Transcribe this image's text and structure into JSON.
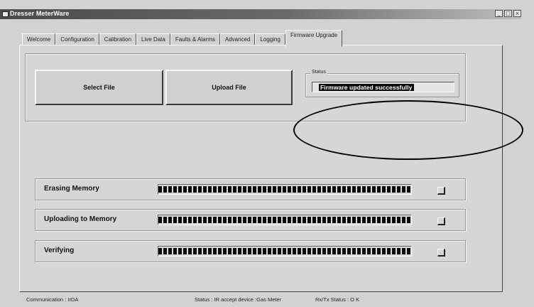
{
  "window": {
    "title": "Dresser MeterWare",
    "icon": "meter-app-icon",
    "controls": [
      "minimize",
      "maximize",
      "close"
    ]
  },
  "tabs": [
    {
      "label": "Welcome",
      "active": false
    },
    {
      "label": "Configuration",
      "active": false
    },
    {
      "label": "Calibration",
      "active": false
    },
    {
      "label": "Live Data",
      "active": false
    },
    {
      "label": "Faults & Alarms",
      "active": false
    },
    {
      "label": "Advanced",
      "active": false
    },
    {
      "label": "Logging",
      "active": false
    },
    {
      "label": "Firmware Upgrade",
      "active": true
    }
  ],
  "upload": {
    "select_file_label": "Select File",
    "upload_file_label": "Upload File",
    "status_legend": "Status",
    "status_text": "Firmware updated successfully"
  },
  "progress": [
    {
      "label": "Erasing Memory",
      "fraction": 1.0
    },
    {
      "label": "Uploading to Memory",
      "fraction": 1.0
    },
    {
      "label": "Verifying",
      "fraction": 1.0
    }
  ],
  "statusbar": {
    "communication": "Communication : IrDA",
    "status": "Status : IR accept device :Gas Meter",
    "rxtx": "Rx/Tx Status : O K"
  }
}
